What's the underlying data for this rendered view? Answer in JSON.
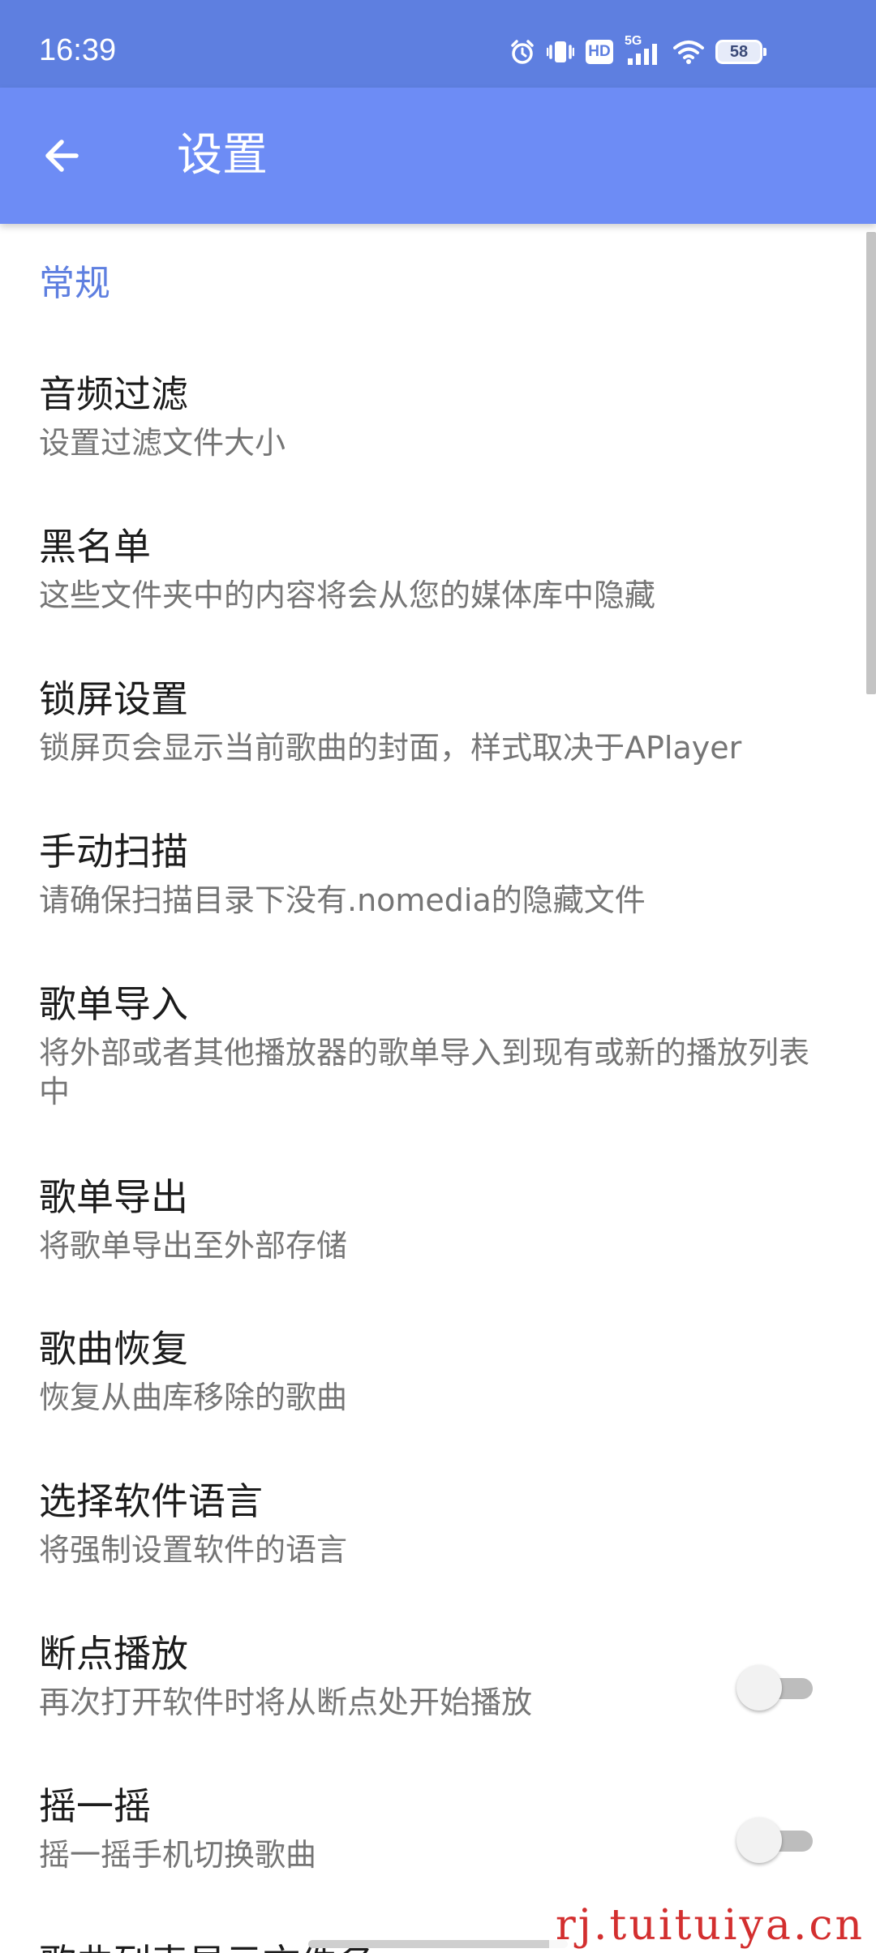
{
  "status_bar": {
    "time": "16:39",
    "network": "5G",
    "hd": "HD",
    "battery": "58",
    "icons": [
      "alarm-icon",
      "vibrate-icon",
      "hd-icon",
      "signal-icon",
      "wifi-icon",
      "battery-icon"
    ]
  },
  "app_bar": {
    "back_icon": "arrow-left-icon",
    "title": "设置"
  },
  "section": {
    "title": "常规"
  },
  "preferences": [
    {
      "title": "音频过滤",
      "summary": "设置过滤文件大小"
    },
    {
      "title": "黑名单",
      "summary": "这些文件夹中的内容将会从您的媒体库中隐藏"
    },
    {
      "title": "锁屏设置",
      "summary": "锁屏页会显示当前歌曲的封面，样式取决于APlayer"
    },
    {
      "title": "手动扫描",
      "summary": "请确保扫描目录下没有.nomedia的隐藏文件"
    },
    {
      "title": "歌单导入",
      "summary": "将外部或者其他播放器的歌单导入到现有或新的播放列表中"
    },
    {
      "title": "歌单导出",
      "summary": "将歌单导出至外部存储"
    },
    {
      "title": "歌曲恢复",
      "summary": "恢复从曲库移除的歌曲"
    },
    {
      "title": "选择软件语言",
      "summary": "将强制设置软件的语言"
    },
    {
      "title": "断点播放",
      "summary": "再次打开软件时将从断点处开始播放",
      "switch": false
    },
    {
      "title": "摇一摇",
      "summary": "摇一摇手机切换歌曲",
      "switch": false
    },
    {
      "title": "歌曲列表显示文件名"
    }
  ],
  "watermark": "rj.tuituiya.cn",
  "colors": {
    "status_bar": "#5e7fe0",
    "app_bar": "#6d8cf5",
    "accent": "#5e7fe0",
    "watermark": "#d32f2f"
  }
}
